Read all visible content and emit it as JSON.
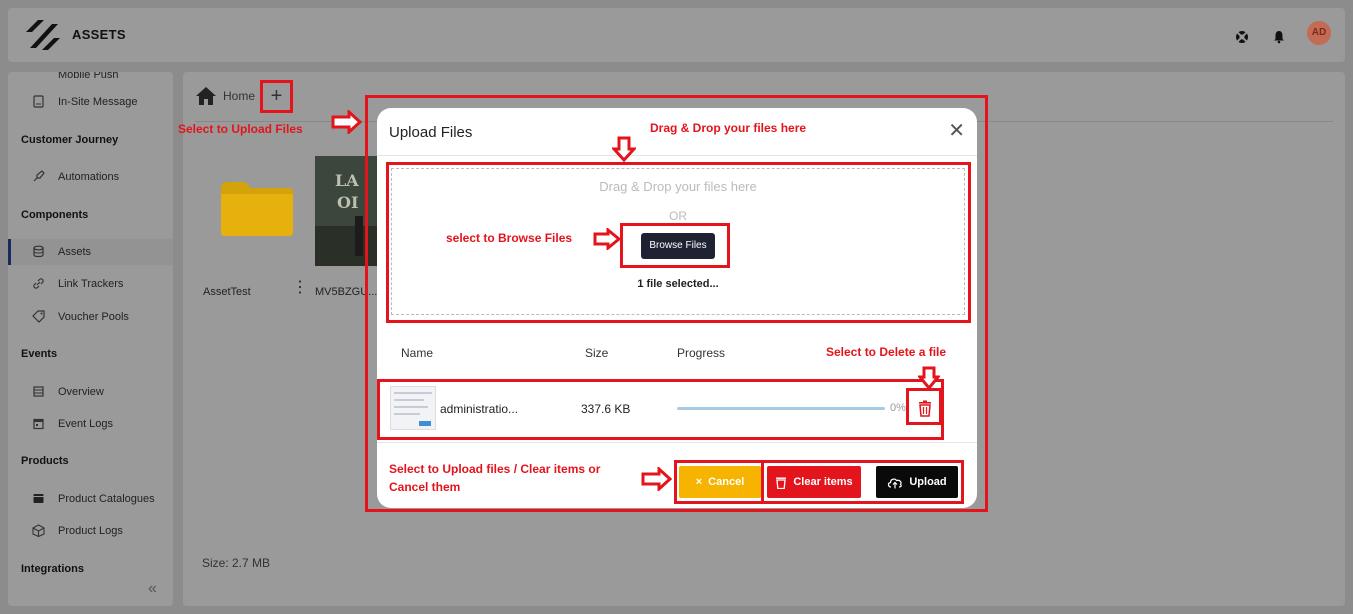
{
  "header": {
    "app_title": "ASSETS",
    "support_icon": "lifebuoy-icon",
    "notifications_icon": "bell-icon",
    "avatar_initials": "AD"
  },
  "sidebar": {
    "top_partial_label": "Mobile Push",
    "items": [
      {
        "label": "In-Site Message",
        "icon": "message-icon"
      },
      {
        "label": "Automations",
        "icon": "rocket-icon"
      },
      {
        "label": "Assets",
        "icon": "database-icon"
      },
      {
        "label": "Link Trackers",
        "icon": "link-icon"
      },
      {
        "label": "Voucher Pools",
        "icon": "tag-icon"
      },
      {
        "label": "Overview",
        "icon": "overview-icon"
      },
      {
        "label": "Event Logs",
        "icon": "calendar-icon"
      },
      {
        "label": "Product Catalogues",
        "icon": "catalogue-icon"
      },
      {
        "label": "Product Logs",
        "icon": "box-icon"
      }
    ],
    "groups": {
      "customer_journey": "Customer Journey",
      "components": "Components",
      "events": "Events",
      "products": "Products",
      "integrations": "Integrations"
    },
    "active_item": "Assets",
    "collapse_glyph": "«"
  },
  "main": {
    "breadcrumb": "Home",
    "add_glyph": "+",
    "assets": [
      {
        "name": "AssetTest",
        "type": "folder"
      },
      {
        "name": "MV5BZGU...",
        "type": "image"
      }
    ],
    "size_label": "Size: 2.7 MB"
  },
  "modal": {
    "title": "Upload Files",
    "close_glyph": "✕",
    "dropzone_text": "Drag & Drop your files here",
    "or_text": "OR",
    "browse_label": "Browse Files",
    "file_selected_text": "1 file selected...",
    "columns": {
      "name": "Name",
      "size": "Size",
      "progress": "Progress"
    },
    "files": [
      {
        "name": "administratio...",
        "size": "337.6 KB",
        "progress_pct": 0,
        "progress_label": "0%"
      }
    ],
    "buttons": {
      "cancel": "Cancel",
      "clear": "Clear items",
      "upload": "Upload"
    },
    "cancel_glyph": "×"
  },
  "annotations": {
    "upload_files": "Select to Upload Files",
    "drag_drop": "Drag & Drop your files here",
    "browse": "select to Browse Files",
    "delete": "Select to Delete a file",
    "footer_line1": "Select to Upload files / Clear items or",
    "footer_line2": "Cancel them"
  },
  "colors": {
    "annotation_red": "#e3141c",
    "cancel_yellow": "#f6b400",
    "clear_red": "#e3141c",
    "upload_black": "#0a0a0a",
    "browse_navy": "#1e2233",
    "progress_blue": "#a6cce4",
    "avatar": "#c26b55"
  }
}
